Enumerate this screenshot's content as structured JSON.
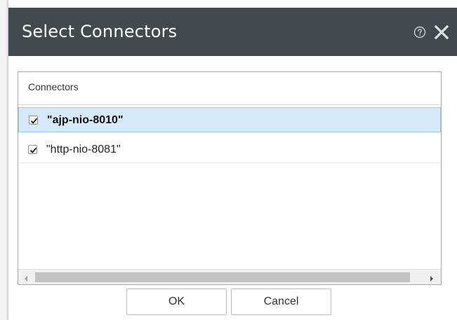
{
  "dialog": {
    "title": "Select Connectors",
    "help_icon": "help-circle-icon",
    "close_icon": "close-icon"
  },
  "grid": {
    "column_header": "Connectors",
    "rows": [
      {
        "label": "\"ajp-nio-8010\"",
        "checked": true,
        "selected": true
      },
      {
        "label": "\"http-nio-8081\"",
        "checked": true,
        "selected": false
      }
    ]
  },
  "buttons": {
    "ok_label": "OK",
    "cancel_label": "Cancel"
  },
  "colors": {
    "titlebar": "#424a4e",
    "selected_row": "#d5e9fb",
    "selected_row_border": "#9ec8ef"
  }
}
